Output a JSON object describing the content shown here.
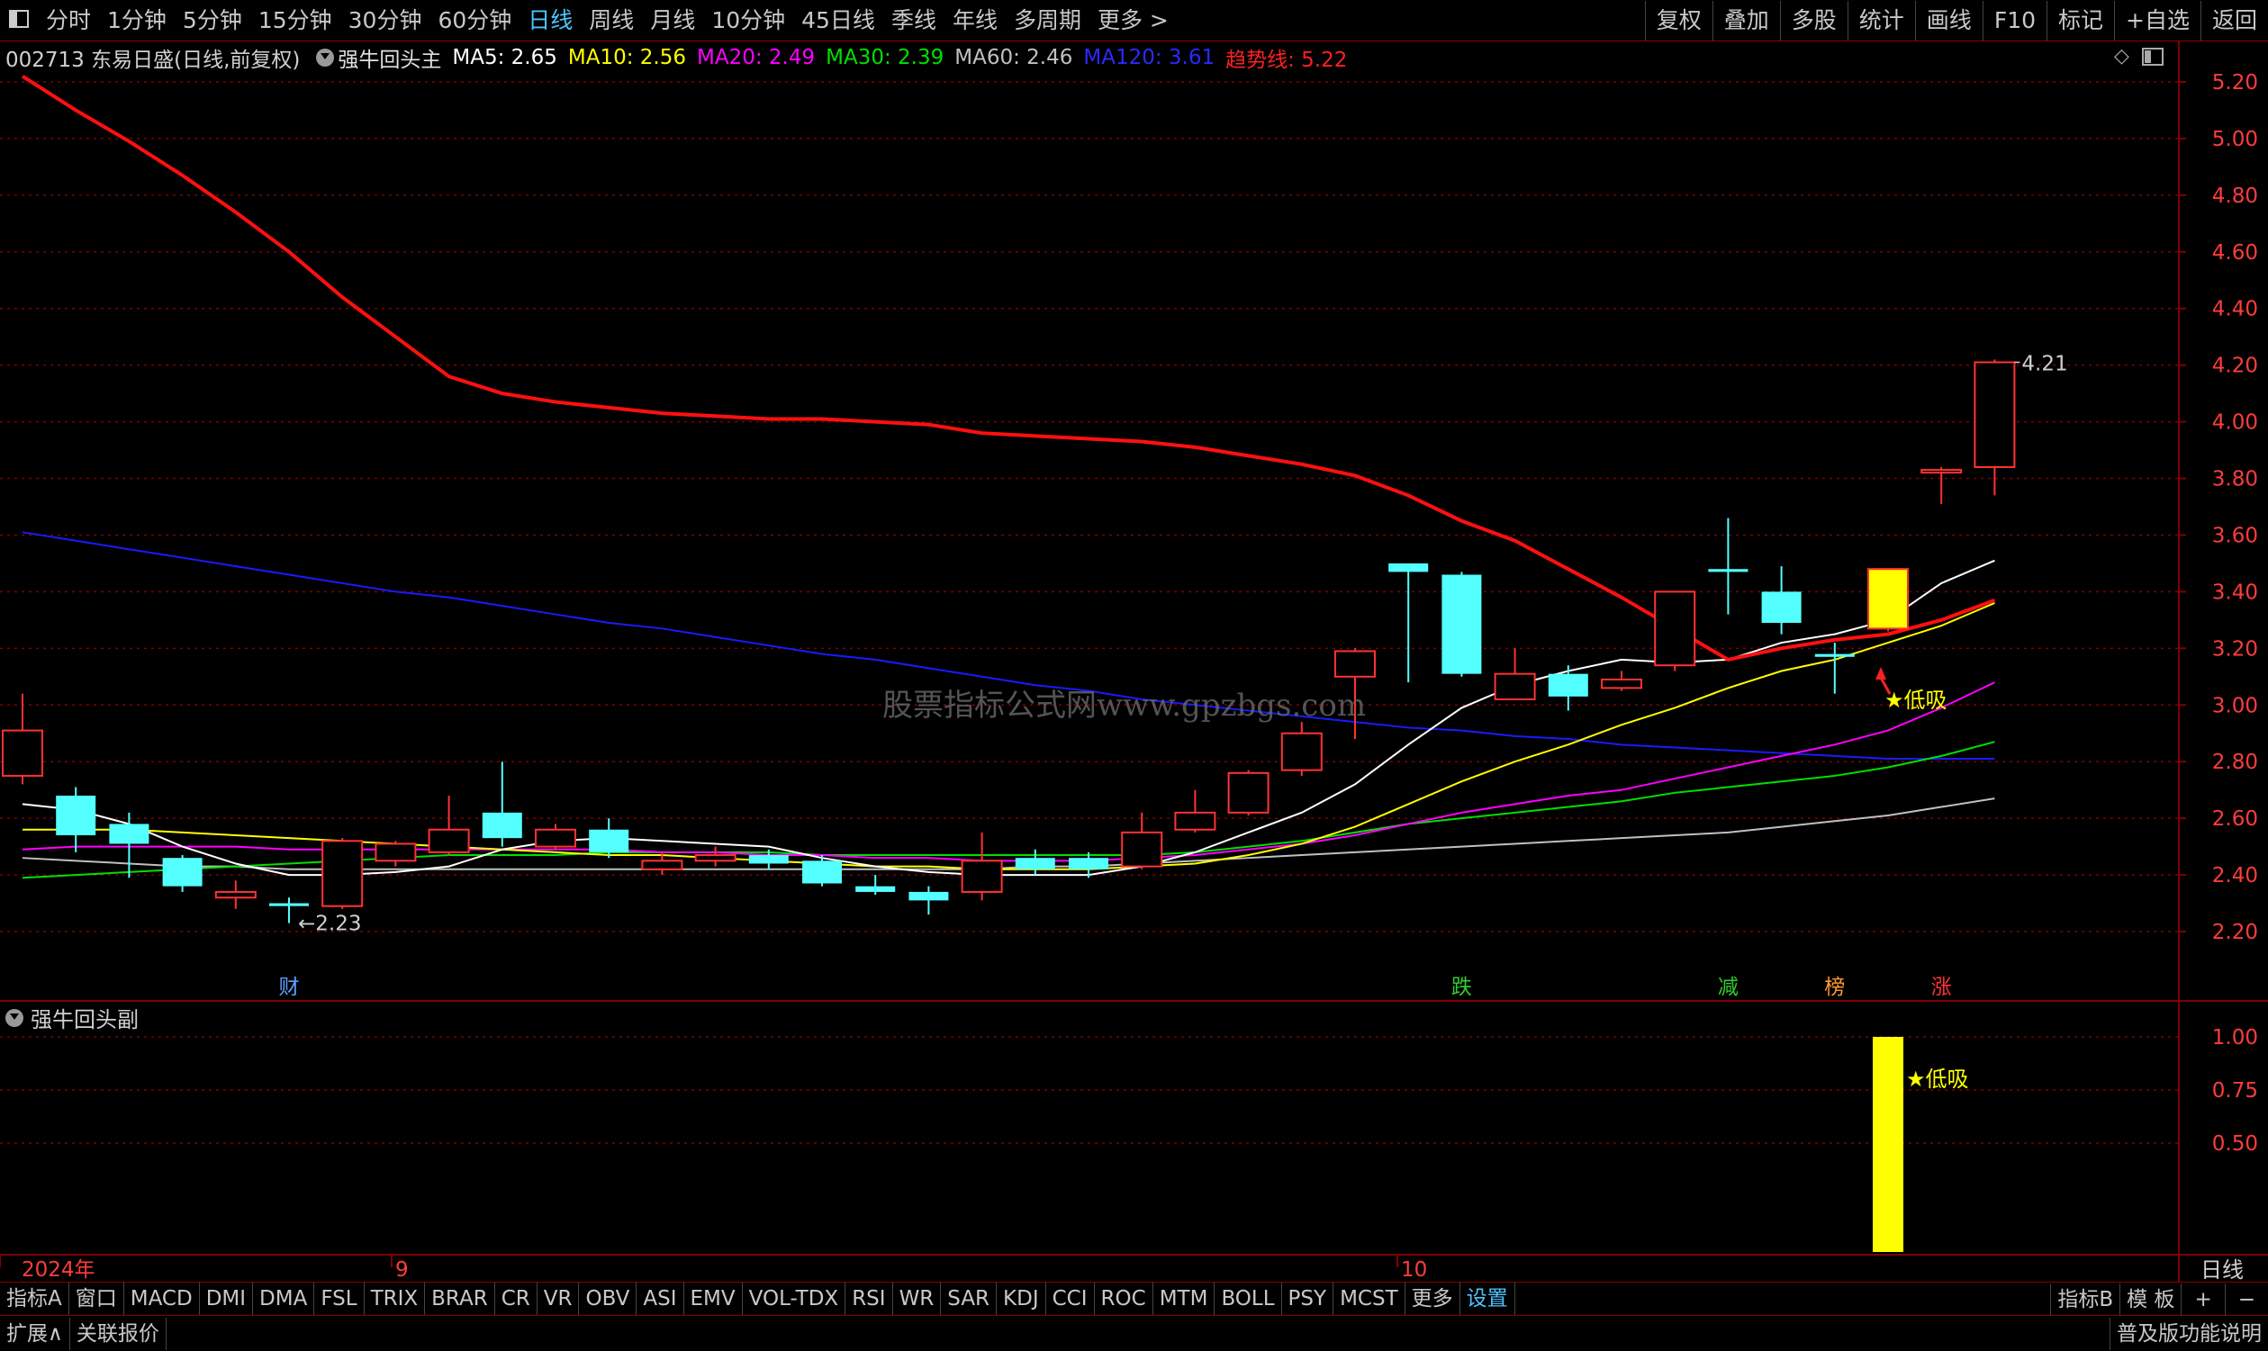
{
  "top_menu": {
    "periods": [
      "分时",
      "1分钟",
      "5分钟",
      "15分钟",
      "30分钟",
      "60分钟",
      "日线",
      "周线",
      "月线",
      "10分钟",
      "45日线",
      "季线",
      "年线",
      "多周期",
      "更多 >"
    ],
    "active_period": "日线",
    "right_buttons": [
      "复权",
      "叠加",
      "多股",
      "统计",
      "画线",
      "F10",
      "标记",
      "+自选",
      "返回"
    ]
  },
  "info": {
    "stock": "002713 东易日盛(日线,前复权)",
    "indicator": "强牛回头主",
    "ma5": "MA5: 2.65",
    "ma10": "MA10: 2.56",
    "ma20": "MA20: 2.49",
    "ma30": "MA30: 2.39",
    "ma60": "MA60: 2.46",
    "ma120": "MA120: 3.61",
    "trend": "趋势线: 5.22"
  },
  "sub_panel": {
    "title": "强牛回头副",
    "signal_label": "★低吸"
  },
  "main_panel": {
    "signal_label": "★低吸",
    "high_label": "4.21",
    "low_label": "←2.23",
    "event_labels": [
      {
        "text": "财",
        "idx": 5,
        "color": "#5aa0ff"
      },
      {
        "text": "跌",
        "idx": 27,
        "color": "#33cc33"
      },
      {
        "text": "减",
        "idx": 32,
        "color": "#33cc33"
      },
      {
        "text": "榜",
        "idx": 34,
        "color": "#ff9933"
      },
      {
        "text": "涨",
        "idx": 36,
        "color": "#ff3333"
      }
    ]
  },
  "time_axis": [
    "2024年",
    "9",
    "10"
  ],
  "y_axis_main": [
    "5.20",
    "5.00",
    "4.80",
    "4.60",
    "4.40",
    "4.20",
    "4.00",
    "3.80",
    "3.60",
    "3.40",
    "3.20",
    "3.00",
    "2.80",
    "2.60",
    "2.40",
    "2.20"
  ],
  "y_axis_sub": [
    "1.00",
    "0.75",
    "0.50"
  ],
  "y_axis_bottom_label": "日线",
  "watermark": "股票指标公式网www.gpzbgs.com",
  "bottom_tabs": [
    "指标A",
    "窗口",
    "MACD",
    "DMI",
    "DMA",
    "FSL",
    "TRIX",
    "BRAR",
    "CR",
    "VR",
    "OBV",
    "ASI",
    "EMV",
    "VOL-TDX",
    "RSI",
    "WR",
    "SAR",
    "KDJ",
    "CCI",
    "ROC",
    "MTM",
    "BOLL",
    "PSY",
    "MCST",
    "更多",
    "设置"
  ],
  "bottom_right": [
    "指标B",
    "模 板",
    "+",
    "−"
  ],
  "status": {
    "left1": "扩展∧",
    "left2": "关联报价",
    "right": "普及版功能说明"
  },
  "colors": {
    "up": "#ff3232",
    "down": "#54ffff",
    "ma5": "#ffffff",
    "ma10": "#ffff00",
    "ma20": "#ff00ff",
    "ma30": "#00e000",
    "ma60": "#c0c0c0",
    "ma120": "#1a1aff",
    "trend": "#ff1010",
    "signal": "#ffff00",
    "grid": "#800000"
  },
  "chart_data": {
    "type": "candlestick",
    "ylim": [
      2.1,
      5.3
    ],
    "candles": [
      {
        "o": 2.75,
        "c": 2.91,
        "h": 3.04,
        "l": 2.72
      },
      {
        "o": 2.68,
        "c": 2.54,
        "h": 2.71,
        "l": 2.48
      },
      {
        "o": 2.58,
        "c": 2.51,
        "h": 2.62,
        "l": 2.39
      },
      {
        "o": 2.46,
        "c": 2.36,
        "h": 2.47,
        "l": 2.34
      },
      {
        "o": 2.32,
        "c": 2.34,
        "h": 2.38,
        "l": 2.28
      },
      {
        "o": 2.3,
        "c": 2.29,
        "h": 2.32,
        "l": 2.23
      },
      {
        "o": 2.29,
        "c": 2.52,
        "h": 2.53,
        "l": 2.28
      },
      {
        "o": 2.45,
        "c": 2.51,
        "h": 2.52,
        "l": 2.43
      },
      {
        "o": 2.48,
        "c": 2.56,
        "h": 2.68,
        "l": 2.47
      },
      {
        "o": 2.62,
        "c": 2.53,
        "h": 2.8,
        "l": 2.5
      },
      {
        "o": 2.5,
        "c": 2.56,
        "h": 2.58,
        "l": 2.49
      },
      {
        "o": 2.56,
        "c": 2.48,
        "h": 2.6,
        "l": 2.46
      },
      {
        "o": 2.42,
        "c": 2.45,
        "h": 2.48,
        "l": 2.4
      },
      {
        "o": 2.45,
        "c": 2.47,
        "h": 2.5,
        "l": 2.43
      },
      {
        "o": 2.47,
        "c": 2.44,
        "h": 2.49,
        "l": 2.42
      },
      {
        "o": 2.45,
        "c": 2.37,
        "h": 2.47,
        "l": 2.36
      },
      {
        "o": 2.36,
        "c": 2.34,
        "h": 2.4,
        "l": 2.33
      },
      {
        "o": 2.34,
        "c": 2.31,
        "h": 2.36,
        "l": 2.26
      },
      {
        "o": 2.34,
        "c": 2.45,
        "h": 2.55,
        "l": 2.31
      },
      {
        "o": 2.46,
        "c": 2.42,
        "h": 2.49,
        "l": 2.4
      },
      {
        "o": 2.46,
        "c": 2.42,
        "h": 2.48,
        "l": 2.39
      },
      {
        "o": 2.43,
        "c": 2.55,
        "h": 2.62,
        "l": 2.42
      },
      {
        "o": 2.56,
        "c": 2.62,
        "h": 2.7,
        "l": 2.55
      },
      {
        "o": 2.62,
        "c": 2.76,
        "h": 2.77,
        "l": 2.61
      },
      {
        "o": 2.77,
        "c": 2.9,
        "h": 2.94,
        "l": 2.75
      },
      {
        "o": 3.1,
        "c": 3.19,
        "h": 3.2,
        "l": 2.88
      },
      {
        "o": 3.5,
        "c": 3.47,
        "h": 3.5,
        "l": 3.08
      },
      {
        "o": 3.46,
        "c": 3.11,
        "h": 3.47,
        "l": 3.1
      },
      {
        "o": 3.02,
        "c": 3.11,
        "h": 3.2,
        "l": 3.02
      },
      {
        "o": 3.11,
        "c": 3.03,
        "h": 3.14,
        "l": 2.98
      },
      {
        "o": 3.06,
        "c": 3.09,
        "h": 3.12,
        "l": 3.05
      },
      {
        "o": 3.14,
        "c": 3.4,
        "h": 3.4,
        "l": 3.12
      },
      {
        "o": 3.48,
        "c": 3.47,
        "h": 3.66,
        "l": 3.32
      },
      {
        "o": 3.4,
        "c": 3.29,
        "h": 3.49,
        "l": 3.25
      },
      {
        "o": 3.18,
        "c": 3.17,
        "h": 3.22,
        "l": 3.04
      },
      {
        "o": 3.27,
        "c": 3.48,
        "h": 3.48,
        "l": 3.26
      },
      {
        "o": 3.83,
        "c": 3.83,
        "h": 3.84,
        "l": 3.71
      },
      {
        "o": 3.84,
        "c": 4.21,
        "h": 4.22,
        "l": 3.74
      }
    ],
    "trend_line": [
      5.22,
      5.1,
      4.99,
      4.87,
      4.74,
      4.6,
      4.44,
      4.3,
      4.16,
      4.1,
      4.07,
      4.05,
      4.03,
      4.02,
      4.01,
      4.01,
      4.0,
      3.99,
      3.96,
      3.95,
      3.94,
      3.93,
      3.91,
      3.88,
      3.85,
      3.81,
      3.74,
      3.65,
      3.58,
      3.48,
      3.38,
      3.27,
      3.16,
      3.2,
      3.23,
      3.25,
      3.3,
      3.37
    ],
    "ma5": [
      2.65,
      2.63,
      2.58,
      2.5,
      2.44,
      2.4,
      2.4,
      2.41,
      2.43,
      2.49,
      2.52,
      2.53,
      2.52,
      2.51,
      2.5,
      2.46,
      2.43,
      2.41,
      2.4,
      2.4,
      2.4,
      2.43,
      2.48,
      2.55,
      2.62,
      2.72,
      2.86,
      2.99,
      3.07,
      3.12,
      3.16,
      3.15,
      3.16,
      3.22,
      3.25,
      3.3,
      3.43,
      3.51
    ],
    "ma10": [
      2.56,
      2.56,
      2.56,
      2.55,
      2.54,
      2.53,
      2.52,
      2.51,
      2.5,
      2.49,
      2.48,
      2.47,
      2.47,
      2.46,
      2.45,
      2.44,
      2.43,
      2.43,
      2.42,
      2.42,
      2.42,
      2.43,
      2.44,
      2.47,
      2.51,
      2.57,
      2.65,
      2.73,
      2.8,
      2.86,
      2.93,
      2.99,
      3.06,
      3.12,
      3.16,
      3.22,
      3.28,
      3.36
    ],
    "ma20": [
      2.49,
      2.5,
      2.5,
      2.5,
      2.5,
      2.49,
      2.49,
      2.49,
      2.49,
      2.49,
      2.49,
      2.49,
      2.48,
      2.48,
      2.47,
      2.47,
      2.46,
      2.46,
      2.45,
      2.45,
      2.45,
      2.46,
      2.47,
      2.49,
      2.51,
      2.54,
      2.58,
      2.62,
      2.65,
      2.68,
      2.7,
      2.74,
      2.78,
      2.82,
      2.86,
      2.91,
      2.99,
      3.08
    ],
    "ma30": [
      2.39,
      2.4,
      2.41,
      2.42,
      2.43,
      2.44,
      2.45,
      2.46,
      2.47,
      2.47,
      2.47,
      2.48,
      2.48,
      2.48,
      2.48,
      2.47,
      2.47,
      2.47,
      2.47,
      2.47,
      2.47,
      2.47,
      2.48,
      2.5,
      2.52,
      2.55,
      2.58,
      2.6,
      2.62,
      2.64,
      2.66,
      2.69,
      2.71,
      2.73,
      2.75,
      2.78,
      2.82,
      2.87
    ],
    "ma60": [
      2.46,
      2.45,
      2.44,
      2.43,
      2.43,
      2.42,
      2.42,
      2.42,
      2.42,
      2.42,
      2.42,
      2.42,
      2.42,
      2.42,
      2.42,
      2.42,
      2.42,
      2.42,
      2.42,
      2.43,
      2.43,
      2.44,
      2.45,
      2.46,
      2.47,
      2.48,
      2.49,
      2.5,
      2.51,
      2.52,
      2.53,
      2.54,
      2.55,
      2.57,
      2.59,
      2.61,
      2.64,
      2.67
    ],
    "ma120": [
      3.61,
      3.58,
      3.55,
      3.52,
      3.49,
      3.46,
      3.43,
      3.4,
      3.38,
      3.35,
      3.32,
      3.29,
      3.27,
      3.24,
      3.21,
      3.18,
      3.16,
      3.13,
      3.1,
      3.07,
      3.05,
      3.02,
      3.0,
      2.98,
      2.96,
      2.94,
      2.92,
      2.91,
      2.89,
      2.88,
      2.86,
      2.85,
      2.84,
      2.83,
      2.82,
      2.81,
      2.81,
      2.81
    ],
    "signal_index": 35,
    "sub_value": 1.0,
    "sub_ylim": [
      0.3,
      1.1
    ]
  }
}
